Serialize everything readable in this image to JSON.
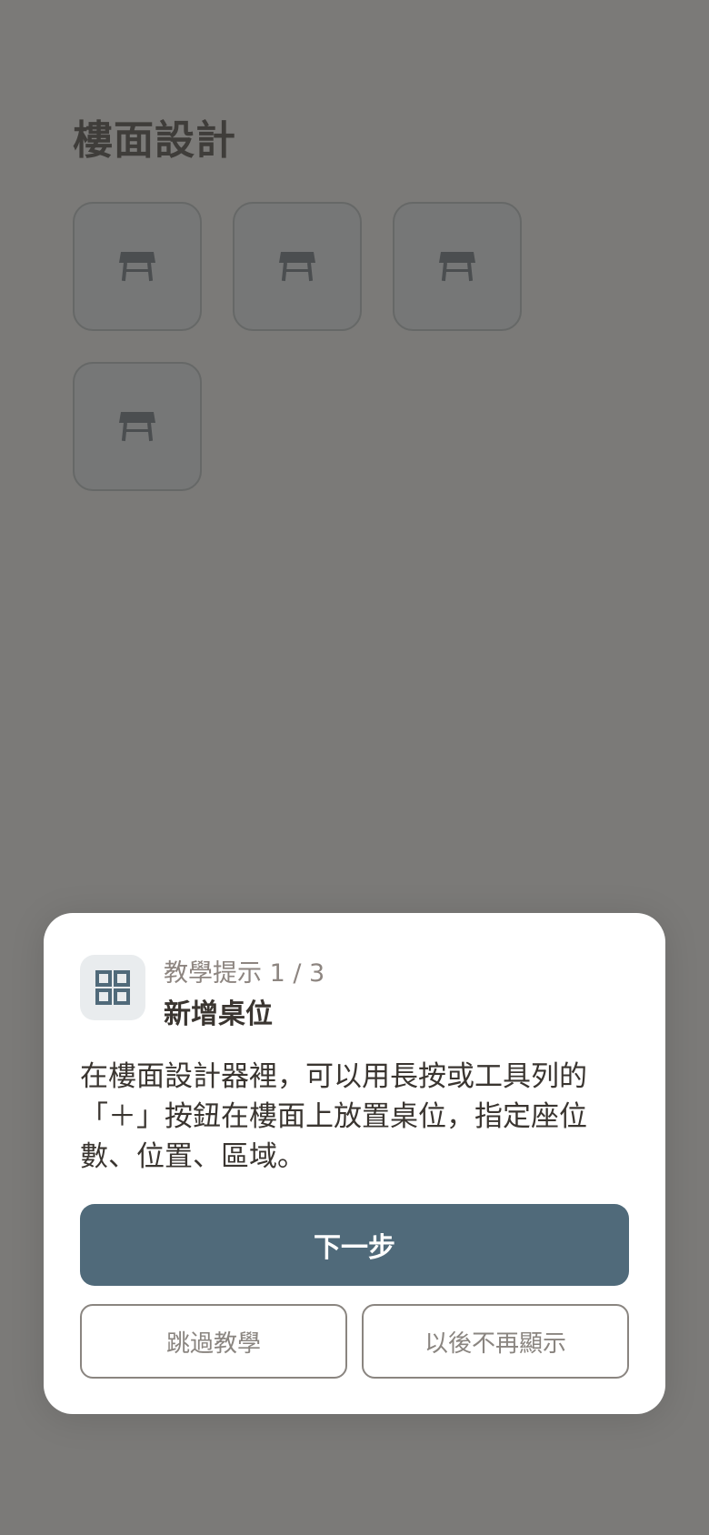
{
  "page": {
    "title": "樓面設計"
  },
  "tables": [
    {
      "icon": "table-icon"
    },
    {
      "icon": "table-icon"
    },
    {
      "icon": "table-icon"
    },
    {
      "icon": "table-icon"
    }
  ],
  "tutorial": {
    "icon": "grid-icon",
    "step_label": "教學提示 1 / 3",
    "title": "新增桌位",
    "body": "在樓面設計器裡，可以用長按或工具列的「＋」按鈕在樓面上放置桌位，指定座位數、位置、區域。",
    "next_label": "下一步",
    "skip_label": "跳過教學",
    "dont_show_label": "以後不再顯示"
  },
  "colors": {
    "overlay_background": "#7b7a78",
    "primary_button": "#506a7a",
    "sheet_background": "#ffffff",
    "muted_text": "#8d8580"
  }
}
